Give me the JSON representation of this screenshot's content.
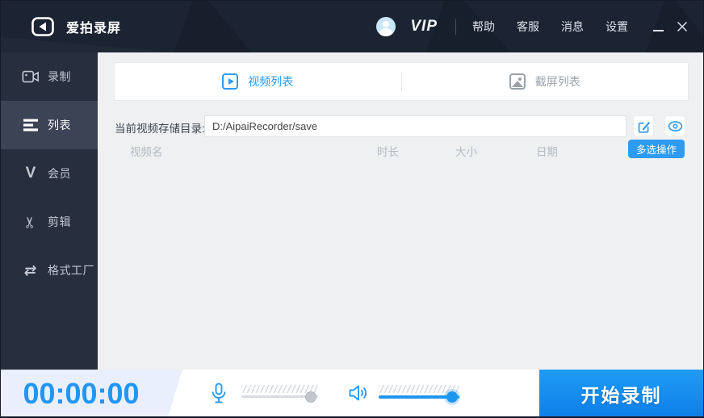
{
  "app": {
    "title": "爱拍录屏"
  },
  "topbar": {
    "vip": "VIP",
    "menu": [
      {
        "label": "帮助"
      },
      {
        "label": "客服"
      },
      {
        "label": "消息"
      },
      {
        "label": "设置"
      }
    ]
  },
  "sidebar": {
    "items": [
      {
        "label": "录制",
        "icon": "camera-icon",
        "active": false
      },
      {
        "label": "列表",
        "icon": "list-icon",
        "active": true
      },
      {
        "label": "会员",
        "icon": "vip-v-icon",
        "active": false
      },
      {
        "label": "剪辑",
        "icon": "scissors-icon",
        "active": false
      },
      {
        "label": "格式工厂",
        "icon": "convert-icon",
        "active": false
      }
    ]
  },
  "tabs": [
    {
      "label": "视频列表",
      "icon": "play-icon",
      "active": true
    },
    {
      "label": "截屏列表",
      "icon": "image-icon",
      "active": false
    }
  ],
  "storage": {
    "label": "当前视频存储目录:",
    "path": "D:/AipaiRecorder/save"
  },
  "list": {
    "columns": [
      "视频名",
      "时长",
      "大小",
      "日期"
    ],
    "multi_select_label": "多选操作",
    "rows": []
  },
  "footer": {
    "timer": "00:00:00",
    "mic_level": 0.93,
    "speaker_level": 0.9,
    "start_label": "开始录制"
  },
  "colors": {
    "accent": "#2196f3",
    "topbar_bg": "#1c2433",
    "sidebar_bg": "#272e3e",
    "sidebar_active_bg": "#3c4355",
    "content_bg": "#eef0f2",
    "timer_panel_bg": "#e9effd",
    "start_button_top": "#1e9cf6",
    "start_button_bottom": "#0e7fe9"
  }
}
